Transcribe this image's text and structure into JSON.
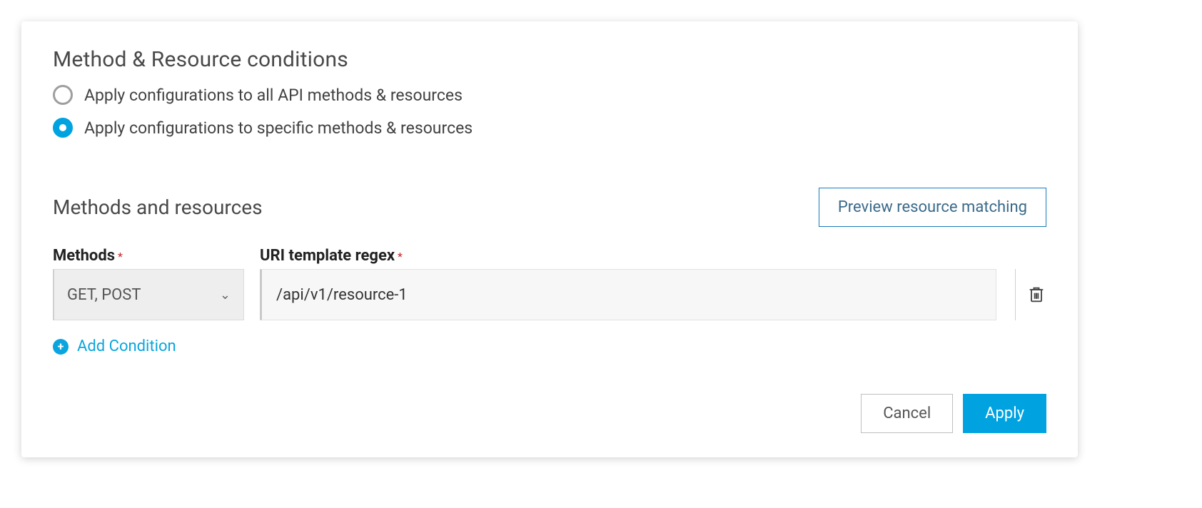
{
  "panel": {
    "title": "Method & Resource conditions",
    "radios": {
      "all": "Apply configurations to all API methods & resources",
      "specific": "Apply configurations to specific methods & resources",
      "selected": "specific"
    }
  },
  "section": {
    "title": "Methods and resources",
    "preview_button": "Preview resource matching",
    "labels": {
      "methods": "Methods",
      "uri": "URI template regex"
    },
    "required_marker": "*"
  },
  "condition": {
    "methods_display": "GET, POST",
    "uri_value": "/api/v1/resource-1"
  },
  "add_condition_label": "Add Condition",
  "footer": {
    "cancel": "Cancel",
    "apply": "Apply"
  },
  "icons": {
    "radio_unchecked": "radio-unchecked-icon",
    "radio_checked": "radio-checked-icon",
    "chevron_down": "chevron-down-icon",
    "trash": "trash-icon",
    "plus_circle": "plus-circle-icon"
  },
  "colors": {
    "accent": "#00a3e0",
    "link": "#0aa5de",
    "danger": "#c62828"
  }
}
